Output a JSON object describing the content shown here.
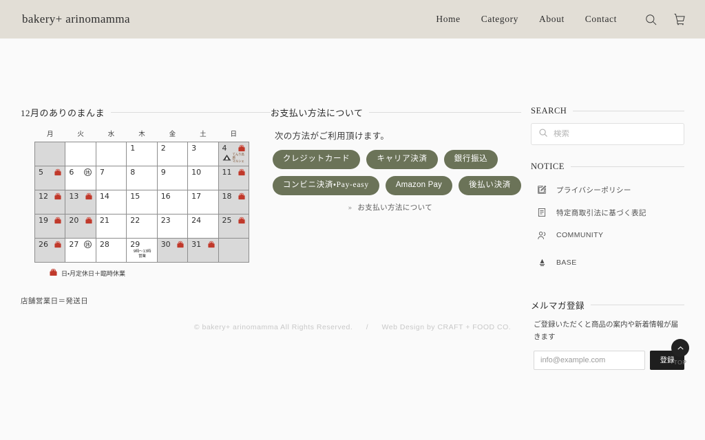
{
  "header": {
    "brand": "bakery+ arinomamma",
    "nav": [
      {
        "label": "Home"
      },
      {
        "label": "Category"
      },
      {
        "label": "About"
      },
      {
        "label": "Contact"
      }
    ],
    "icons": [
      {
        "name": "search-icon"
      },
      {
        "name": "cart-icon"
      }
    ]
  },
  "calendar": {
    "title": "12月のありのまんま",
    "weekdays": [
      "月",
      "火",
      "水",
      "木",
      "金",
      "土",
      "日"
    ],
    "weeks": [
      [
        {
          "day": "",
          "state": "pad"
        },
        {
          "day": "",
          "state": "blank"
        },
        {
          "day": "",
          "state": "blank"
        },
        {
          "day": "1",
          "state": "open"
        },
        {
          "day": "2",
          "state": "open"
        },
        {
          "day": "3",
          "state": "open"
        },
        {
          "day": "4",
          "state": "off",
          "mark": "rest",
          "badge": "てんり高原\nマルシェ"
        }
      ],
      [
        {
          "day": "5",
          "state": "off",
          "mark": "rest"
        },
        {
          "day": "6",
          "state": "open",
          "mark": "kyu"
        },
        {
          "day": "7",
          "state": "open"
        },
        {
          "day": "8",
          "state": "open"
        },
        {
          "day": "9",
          "state": "open"
        },
        {
          "day": "10",
          "state": "open"
        },
        {
          "day": "11",
          "state": "off",
          "mark": "rest"
        }
      ],
      [
        {
          "day": "12",
          "state": "off",
          "mark": "rest"
        },
        {
          "day": "13",
          "state": "off",
          "mark": "rest"
        },
        {
          "day": "14",
          "state": "open"
        },
        {
          "day": "15",
          "state": "open"
        },
        {
          "day": "16",
          "state": "open"
        },
        {
          "day": "17",
          "state": "open"
        },
        {
          "day": "18",
          "state": "off",
          "mark": "rest"
        }
      ],
      [
        {
          "day": "19",
          "state": "off",
          "mark": "rest"
        },
        {
          "day": "20",
          "state": "off",
          "mark": "rest"
        },
        {
          "day": "21",
          "state": "open"
        },
        {
          "day": "22",
          "state": "open"
        },
        {
          "day": "23",
          "state": "open"
        },
        {
          "day": "24",
          "state": "open"
        },
        {
          "day": "25",
          "state": "off",
          "mark": "rest"
        }
      ],
      [
        {
          "day": "26",
          "state": "off",
          "mark": "rest"
        },
        {
          "day": "27",
          "state": "open",
          "mark": "kyu"
        },
        {
          "day": "28",
          "state": "open"
        },
        {
          "day": "29",
          "state": "open",
          "note": "9時〜13時\n営業"
        },
        {
          "day": "30",
          "state": "off",
          "mark": "rest"
        },
        {
          "day": "31",
          "state": "off",
          "mark": "rest"
        },
        {
          "day": "",
          "state": "pad"
        }
      ]
    ],
    "legend": "日・月定休日＋臨時休業",
    "shipping_note": "店舗営業日＝発送日"
  },
  "payment": {
    "title": "お支払い方法について",
    "lead": "次の方法がご利用頂けます。",
    "methods_row1": [
      "クレジットカード",
      "キャリア決済",
      "銀行振込"
    ],
    "methods_row2": [
      "コンビニ決済・Pay-easy",
      "Amazon Pay",
      "後払い決済"
    ],
    "link_chevron": "»",
    "link_label": "お支払い方法について",
    "pill_color": "#6b7358"
  },
  "sidebar": {
    "search": {
      "title": "SEARCH",
      "placeholder": "検索",
      "value": ""
    },
    "notice": {
      "title": "NOTICE",
      "items": [
        {
          "label": "プライバシーポリシー",
          "icon": "pencil-square-icon"
        },
        {
          "label": "特定商取引法に基づく表記",
          "icon": "document-icon"
        },
        {
          "label": "COMMUNITY",
          "icon": "people-icon"
        },
        {
          "label": "BASE",
          "icon": "base-logo-icon"
        }
      ]
    },
    "newsletter": {
      "title": "メルマガ登録",
      "description": "ご登録いただくと商品の案内や新着情報が届きます",
      "email_placeholder": "info@example.com",
      "email_value": "",
      "submit_label": "登録"
    }
  },
  "footer": {
    "copyright": "© bakery+ arinomamma  All  Rights Reserved.",
    "separator": "/",
    "credit": "Web Design by CRAFT + FOOD CO.",
    "to_top_label": "TOP"
  }
}
